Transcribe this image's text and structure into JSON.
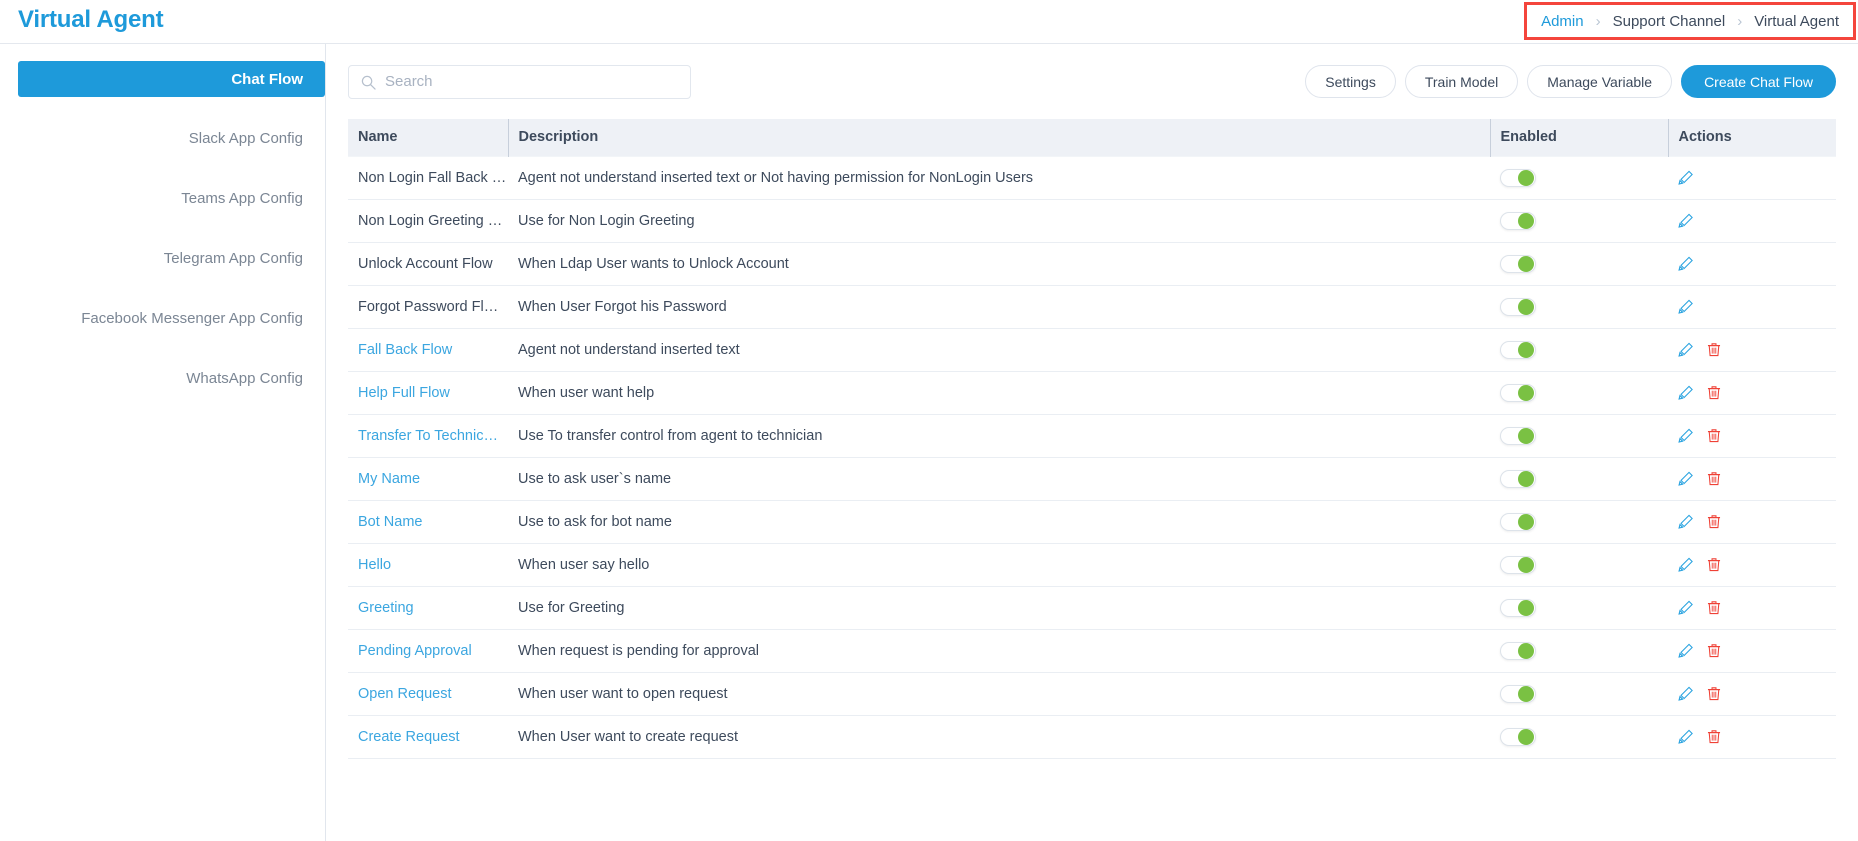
{
  "header": {
    "title": "Virtual Agent",
    "breadcrumb": [
      {
        "label": "Admin",
        "link": true
      },
      {
        "label": "Support Channel",
        "link": false
      },
      {
        "label": "Virtual Agent",
        "link": false
      }
    ],
    "separator": "›",
    "highlight_color": "#f4453c"
  },
  "sidebar": {
    "items": [
      {
        "label": "Chat Flow",
        "active": true
      },
      {
        "label": "Slack App Config",
        "active": false
      },
      {
        "label": "Teams App Config",
        "active": false
      },
      {
        "label": "Telegram App Config",
        "active": false
      },
      {
        "label": "Facebook Messenger App Config",
        "active": false
      },
      {
        "label": "WhatsApp Config",
        "active": false
      }
    ]
  },
  "toolbar": {
    "search": {
      "value": "",
      "placeholder": "Search",
      "icon": "search-icon"
    },
    "buttons": [
      {
        "label": "Settings",
        "primary": false
      },
      {
        "label": "Train Model",
        "primary": false
      },
      {
        "label": "Manage Variable",
        "primary": false
      },
      {
        "label": "Create Chat Flow",
        "primary": true
      }
    ]
  },
  "table": {
    "columns": [
      "Name",
      "Description",
      "Enabled",
      "Actions"
    ],
    "rows": [
      {
        "name": "Non Login Fall Back …",
        "desc": "Agent not understand inserted text or Not having permission for NonLogin Users",
        "enabled": true,
        "link": false,
        "deletable": false
      },
      {
        "name": "Non Login Greeting …",
        "desc": "Use for Non Login Greeting",
        "enabled": true,
        "link": false,
        "deletable": false
      },
      {
        "name": "Unlock Account Flow",
        "desc": "When Ldap User wants to Unlock Account",
        "enabled": true,
        "link": false,
        "deletable": false
      },
      {
        "name": "Forgot Password Fl…",
        "desc": "When User Forgot his Password",
        "enabled": true,
        "link": false,
        "deletable": false
      },
      {
        "name": "Fall Back Flow",
        "desc": "Agent not understand inserted text",
        "enabled": true,
        "link": true,
        "deletable": true
      },
      {
        "name": "Help Full Flow",
        "desc": "When user want help",
        "enabled": true,
        "link": true,
        "deletable": true
      },
      {
        "name": "Transfer To Technic…",
        "desc": "Use To transfer control from agent to technician",
        "enabled": true,
        "link": true,
        "deletable": true
      },
      {
        "name": "My Name",
        "desc": "Use to ask user`s name",
        "enabled": true,
        "link": true,
        "deletable": true
      },
      {
        "name": "Bot Name",
        "desc": "Use to ask for bot name",
        "enabled": true,
        "link": true,
        "deletable": true
      },
      {
        "name": "Hello",
        "desc": "When user say hello",
        "enabled": true,
        "link": true,
        "deletable": true
      },
      {
        "name": "Greeting",
        "desc": "Use for Greeting",
        "enabled": true,
        "link": true,
        "deletable": true
      },
      {
        "name": "Pending Approval",
        "desc": "When request is pending for approval",
        "enabled": true,
        "link": true,
        "deletable": true
      },
      {
        "name": "Open Request",
        "desc": "When user want to open request",
        "enabled": true,
        "link": true,
        "deletable": true
      },
      {
        "name": "Create Request",
        "desc": "When User want to create request",
        "enabled": true,
        "link": true,
        "deletable": true
      }
    ]
  },
  "colors": {
    "accent": "#1e9ada",
    "link": "#3ba6e0",
    "toggle_on": "#7ac143",
    "delete": "#ef4136",
    "edit": "#29a3e0",
    "header_bg": "#eef1f6"
  }
}
